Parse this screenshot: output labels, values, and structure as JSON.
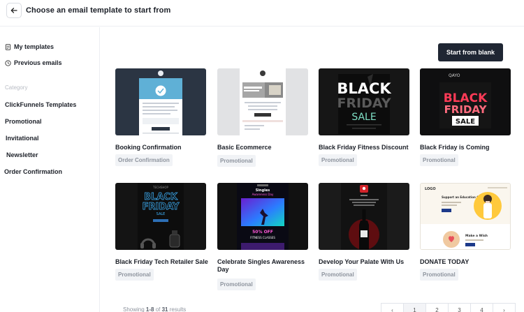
{
  "header": {
    "title": "Choose an email template to start from"
  },
  "sidebar": {
    "links": [
      {
        "label": "My templates",
        "icon": "document-icon"
      },
      {
        "label": "Previous emails",
        "icon": "clock-icon"
      }
    ],
    "category_heading": "Category",
    "categories": [
      "ClickFunnels Templates",
      "Promotional",
      "Invitational",
      "Newsletter",
      "Order Confirmation"
    ]
  },
  "actions": {
    "start_blank": "Start from blank"
  },
  "templates": [
    {
      "name": "Booking Confirmation",
      "tag": "Order Confirmation"
    },
    {
      "name": "Basic Ecommerce",
      "tag": "Promotional"
    },
    {
      "name": "Black Friday Fitness Discount",
      "tag": "Promotional"
    },
    {
      "name": "Black Friday is Coming",
      "tag": "Promotional"
    },
    {
      "name": "Black Friday Tech Retailer Sale",
      "tag": "Promotional"
    },
    {
      "name": "Celebrate Singles Awareness Day",
      "tag": "Promotional"
    },
    {
      "name": "Develop Your Palate With Us",
      "tag": "Promotional"
    },
    {
      "name": "DONATE TODAY",
      "tag": "Promotional"
    }
  ],
  "thumb_text": {
    "fitness": [
      "BLACK",
      "FRIDAY",
      "SALE"
    ],
    "coming": [
      "QAYO",
      "BLACK",
      "FRIDAY",
      "SALE"
    ],
    "tech": [
      "TECHSHOP",
      "BLACK",
      "FRIDAY",
      "SALE"
    ],
    "singles": [
      "Singles",
      "Awareness Day",
      "50% OFF",
      "FITNESS CLASSES"
    ],
    "donate": [
      "LOGO",
      "Support an Education Cause",
      "Make a Wish"
    ]
  },
  "pagination": {
    "prefix": "Showing ",
    "range": "1-8",
    "of": " of ",
    "total": "31",
    "suffix": " results",
    "pages": [
      "1",
      "2",
      "3",
      "4"
    ],
    "prev": "‹",
    "next": "›"
  }
}
